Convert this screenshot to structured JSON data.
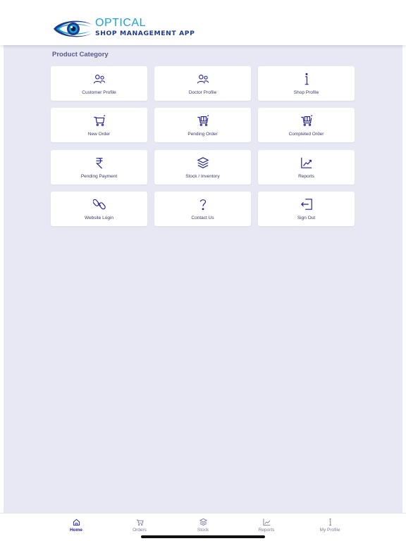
{
  "header": {
    "brand_line1": "OPTICAL",
    "brand_line2": "SHOP MANAGEMENT APP"
  },
  "section_title": "Product Category",
  "colors": {
    "accent": "#1f1fa8",
    "background": "#e7e8f3",
    "brand_light": "#1aa3d9",
    "brand_dark": "#1e3a8a"
  },
  "categories": [
    {
      "label": "Customer Profile",
      "icon": "users-icon"
    },
    {
      "label": "Doctor Profile",
      "icon": "users-icon"
    },
    {
      "label": "Shop Profile",
      "icon": "info-icon"
    },
    {
      "label": "New Order",
      "icon": "cart-icon"
    },
    {
      "label": "Pending Order",
      "icon": "cart-box-icon"
    },
    {
      "label": "Completed Order",
      "icon": "cart-box-icon"
    },
    {
      "label": "Pending Payment",
      "icon": "rupee-icon"
    },
    {
      "label": "Stock / Inventory",
      "icon": "layers-icon"
    },
    {
      "label": "Reports",
      "icon": "chart-icon"
    },
    {
      "label": "Website Login",
      "icon": "link-icon"
    },
    {
      "label": "Contact Us",
      "icon": "question-icon"
    },
    {
      "label": "Sign Out",
      "icon": "sign-out-icon"
    }
  ],
  "tabs": [
    {
      "label": "Home",
      "icon": "home-icon",
      "active": true
    },
    {
      "label": "Orders",
      "icon": "cart-icon",
      "active": false
    },
    {
      "label": "Stock",
      "icon": "layers-icon",
      "active": false
    },
    {
      "label": "Reports",
      "icon": "chart-icon",
      "active": false
    },
    {
      "label": "My Profile",
      "icon": "info-icon",
      "active": false
    }
  ]
}
